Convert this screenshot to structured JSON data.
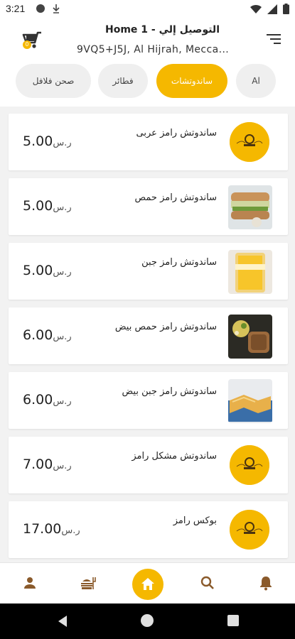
{
  "status_bar": {
    "time": "3:21",
    "icons_left": [
      "circle-icon",
      "download-icon"
    ],
    "icons_right": [
      "wifi-icon",
      "signal-icon",
      "battery-icon"
    ]
  },
  "header": {
    "delivery_title": "التوصيل إلي - Home 1",
    "delivery_address": "9VQ5+J5J, Al Hijrah, Mecca...",
    "cart_badge": "0",
    "icons": [
      "cart-icon",
      "menu-icon"
    ]
  },
  "categories": [
    {
      "label": "Al",
      "active": false
    },
    {
      "label": "ساندوتشات",
      "active": true
    },
    {
      "label": "فطائر",
      "active": false
    },
    {
      "label": "صحن فلافل",
      "active": false
    }
  ],
  "products": [
    {
      "name": "ساندوتش رامز عربى",
      "price": "5.00",
      "currency": "ر.س",
      "thumb": "logo"
    },
    {
      "name": "ساندوتش رامز حمص",
      "price": "5.00",
      "currency": "ر.س",
      "thumb": "photo-sandwich"
    },
    {
      "name": "ساندوتش رامز جبن",
      "price": "5.00",
      "currency": "ر.س",
      "thumb": "photo-cheese"
    },
    {
      "name": "ساندوتش رامز حمص بيض",
      "price": "6.00",
      "currency": "ر.س",
      "thumb": "photo-egg"
    },
    {
      "name": "ساندوتش رامز جبن بيض",
      "price": "6.00",
      "currency": "ر.س",
      "thumb": "photo-toast"
    },
    {
      "name": "ساندوتش  مشكل رامز",
      "price": "7.00",
      "currency": "ر.س",
      "thumb": "logo"
    },
    {
      "name": "بوكس رامز",
      "price": "17.00",
      "currency": "ر.س",
      "thumb": "logo"
    }
  ],
  "bottom_nav": [
    "profile-icon",
    "menu-book-icon",
    "home-icon",
    "search-icon",
    "bell-icon"
  ],
  "colors": {
    "accent": "#f5b800",
    "nav_icon": "#8a5a2b",
    "list_background": "#f2f2f2"
  }
}
